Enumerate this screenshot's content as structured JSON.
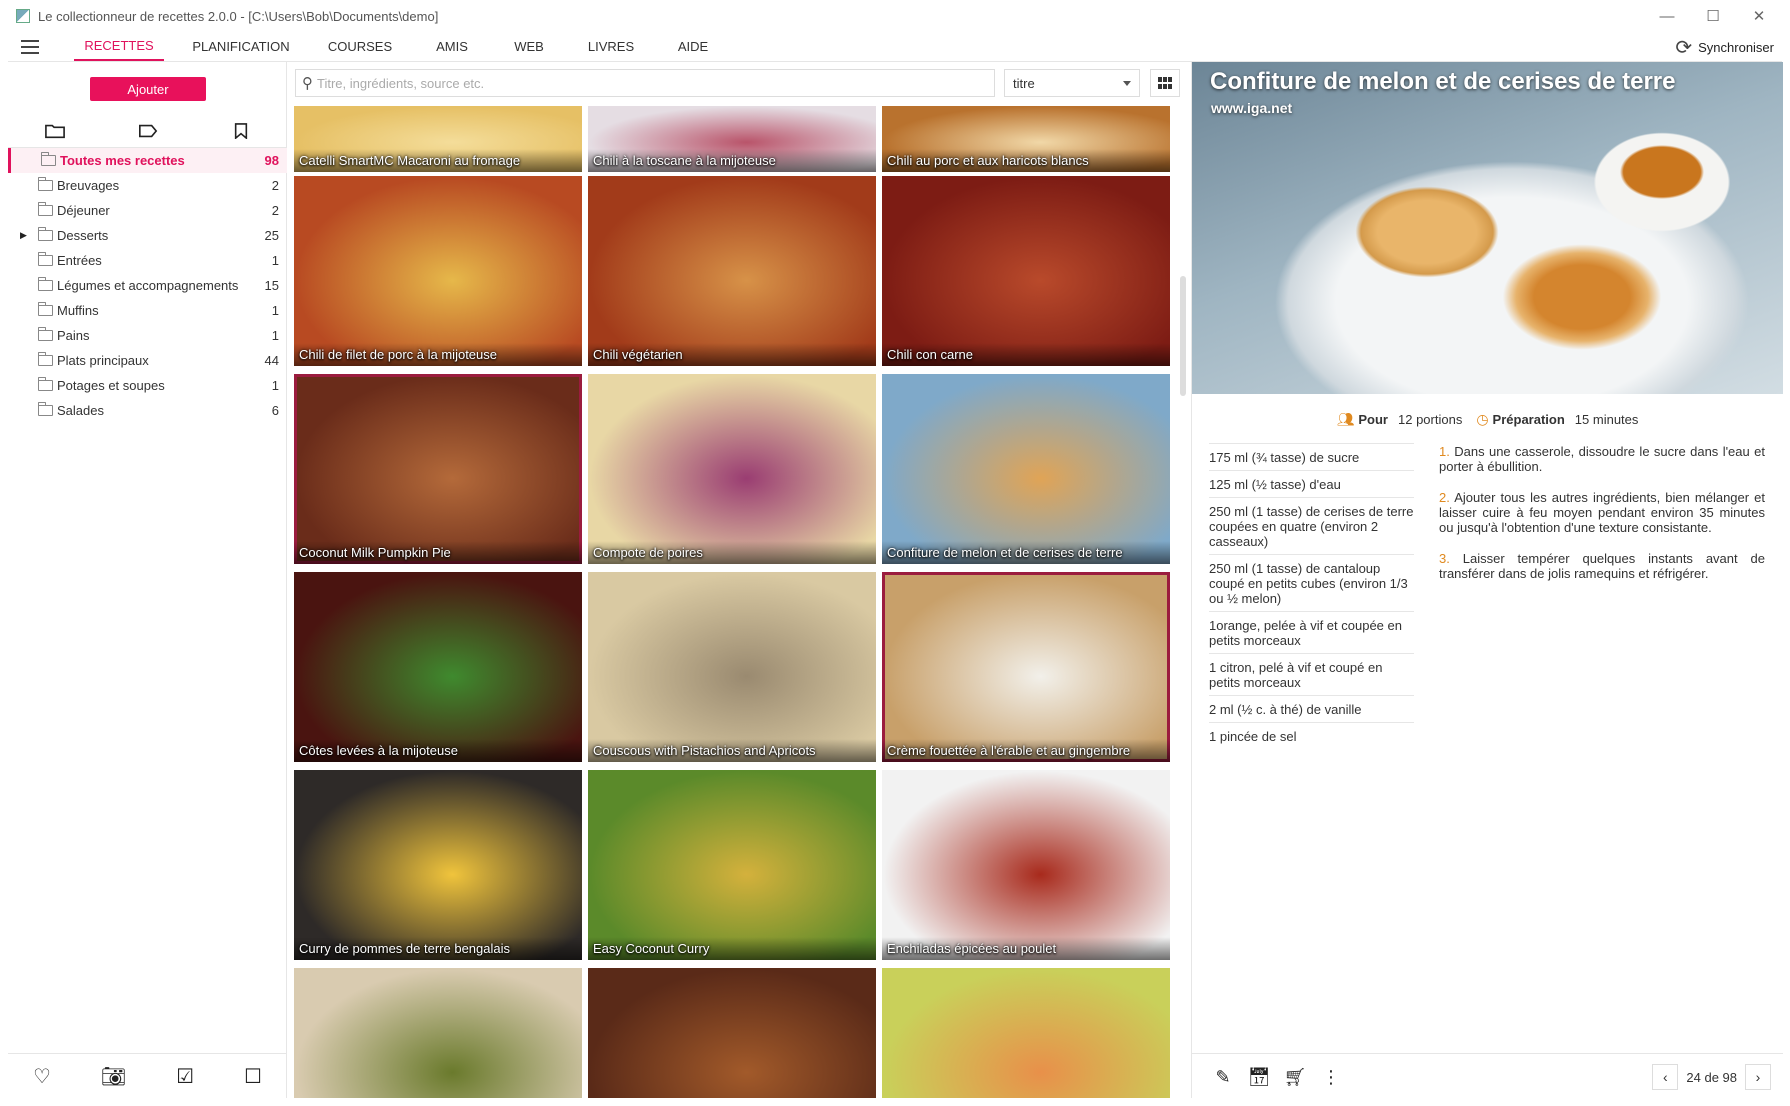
{
  "window": {
    "title": "Le collectionneur de recettes 2.0.0 -  [C:\\Users\\Bob\\Documents\\demo]",
    "minimize": "—",
    "maximize": "☐",
    "close": "✕"
  },
  "nav": {
    "tabs": [
      "RECETTES",
      "PLANIFICATION",
      "COURSES",
      "AMIS",
      "WEB",
      "LIVRES",
      "AIDE"
    ],
    "active": "RECETTES",
    "sync_label": "Synchroniser",
    "sync_icon": "sync-icon"
  },
  "sidebar": {
    "add_label": "Ajouter",
    "tab_icons": [
      "folder-icon",
      "tag-icon",
      "bookmark-icon"
    ],
    "folders": [
      {
        "name": "Toutes mes recettes",
        "count": "98",
        "active": true
      },
      {
        "name": "Breuvages",
        "count": "2"
      },
      {
        "name": "Déjeuner",
        "count": "2"
      },
      {
        "name": "Desserts",
        "count": "25",
        "expandable": true
      },
      {
        "name": "Entrées",
        "count": "1"
      },
      {
        "name": "Légumes et accompagnements",
        "count": "15"
      },
      {
        "name": "Muffins",
        "count": "1"
      },
      {
        "name": "Pains",
        "count": "1"
      },
      {
        "name": "Plats principaux",
        "count": "44"
      },
      {
        "name": "Potages et soupes",
        "count": "1"
      },
      {
        "name": "Salades",
        "count": "6"
      }
    ],
    "footer_icons": [
      "heart-icon",
      "camera-icon",
      "checkbox-checked-icon",
      "checkbox-empty-icon"
    ]
  },
  "search": {
    "placeholder": "Titre, ingrédients, source etc.",
    "sort_value": "titre"
  },
  "recipes": [
    {
      "title": "Catelli SmartMC Macaroni au fromage",
      "bg": "#e6c065",
      "bg2": "#f4dd9a"
    },
    {
      "title": "Chili à la toscane à la mijoteuse",
      "bg": "#e5dde3",
      "bg2": "#b9546a"
    },
    {
      "title": "Chili au porc et aux haricots blancs",
      "bg": "#b9722e",
      "bg2": "#f1d8a8"
    },
    {
      "title": "Chili de filet de porc à la mijoteuse",
      "bg": "#b84a22",
      "bg2": "#e6b84a"
    },
    {
      "title": "Chili végétarien",
      "bg": "#a23b1a",
      "bg2": "#d79248"
    },
    {
      "title": "Chili con carne",
      "bg": "#7d1c14",
      "bg2": "#b94a2b"
    },
    {
      "title": "Coconut Milk Pumpkin Pie",
      "bg": "#6a2c1a",
      "bg2": "#b46a3a",
      "selected": true
    },
    {
      "title": "Compote de poires",
      "bg": "#e8d7a5",
      "bg2": "#9a3d72"
    },
    {
      "title": "Confiture de melon et de cerises de terre",
      "bg": "#7fa9c9",
      "bg2": "#e0a456"
    },
    {
      "title": "Côtes levées à la mijoteuse",
      "bg": "#4a1410",
      "bg2": "#3f8a2e"
    },
    {
      "title": "Couscous with Pistachios and Apricots",
      "bg": "#d9c9a2",
      "bg2": "#9a8a70"
    },
    {
      "title": "Crème fouettée à l'érable et au gingembre",
      "bg": "#c8a06a",
      "bg2": "#f2f0ea",
      "selected": true
    },
    {
      "title": "Curry de pommes de terre bengalais",
      "bg": "#2e2a28",
      "bg2": "#f0c43c"
    },
    {
      "title": "Easy Coconut Curry",
      "bg": "#5b8a2a",
      "bg2": "#d4b13c"
    },
    {
      "title": "Enchiladas épicées au poulet",
      "bg": "#f2f2f2",
      "bg2": "#a82a1c"
    },
    {
      "title": "",
      "bg": "#d9cbb0",
      "bg2": "#6a7a2c"
    },
    {
      "title": "",
      "bg": "#5a2a18",
      "bg2": "#a25a2a"
    },
    {
      "title": "",
      "bg": "#c9d05a",
      "bg2": "#e8904a"
    }
  ],
  "detail": {
    "title": "Confiture de melon et de cerises de terre",
    "source": "www.iga.net",
    "servings_label": "Pour",
    "servings_value": "12 portions",
    "prep_label": "Préparation",
    "prep_value": "15 minutes",
    "ingredients": [
      "175 ml (¾ tasse) de sucre",
      "125 ml (½ tasse) d'eau",
      "250 ml (1 tasse) de cerises de terre coupées en quatre (environ 2 casseaux)",
      "250 ml (1 tasse) de cantaloup coupé en petits cubes (environ 1/3 ou ½ melon)",
      "1orange, pelée à vif et coupée en petits morceaux",
      "1 citron, pelé à vif et coupé en petits morceaux",
      "2 ml (½ c. à thé) de vanille",
      "1 pincée de sel"
    ],
    "steps": [
      {
        "num": "1.",
        "text": "Dans une casserole, dissoudre le sucre dans l'eau et porter à ébullition."
      },
      {
        "num": "2.",
        "text": "Ajouter tous les autres ingrédients, bien mélanger et laisser cuire à feu moyen pendant environ 35 minutes ou jusqu'à l'obtention d'une texture consistante."
      },
      {
        "num": "3.",
        "text": "Laisser tempérer quelques instants avant de transférer dans de jolis ramequins et réfrigérer."
      }
    ],
    "toolbar_icons": [
      "edit-icon",
      "calendar-icon",
      "add-to-cart-icon",
      "more-icon"
    ],
    "pager": "24 de 98"
  },
  "colors": {
    "accent": "#e0125c",
    "orange": "#e08a20"
  }
}
